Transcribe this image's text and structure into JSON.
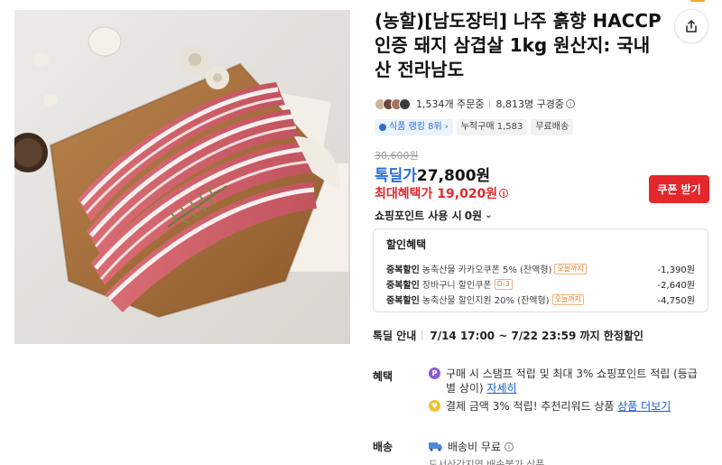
{
  "product": {
    "title": "(농할)[남도장터] 나주 흙향 HACCP인증 돼지 삼겹살 1kg 원산지: 국내산 전라남도",
    "image_alt": "삼겹살 product photo"
  },
  "stats": {
    "orders": "1,534개 주문중",
    "viewers": "8,813명 구경중"
  },
  "chips": {
    "rank": "식품 랭킹 8위",
    "cumulative": "누적구매 1,583",
    "free_shipping": "무료배송"
  },
  "price": {
    "original": "30,600원",
    "deal_label": "톡딜가",
    "deal_value": "27,800원",
    "max_benefit": "최대혜택가 19,020원",
    "coupon_button": "쿠폰 받기",
    "points": "쇼핑포인트 사용 시",
    "points_value": "0원"
  },
  "discounts": {
    "title": "할인혜택",
    "rows": [
      {
        "kind": "중복할인",
        "desc": "농축산물 카카오쿠폰 5% (잔액형)",
        "tag": "오늘까지",
        "amount": "-1,390원"
      },
      {
        "kind": "중복할인",
        "desc": "장바구니 할인쿠폰",
        "tag": "D-3",
        "amount": "-2,640원"
      },
      {
        "kind": "중복할인",
        "desc": "농축산물 할인지원 20% (잔액형)",
        "tag": "오늘까지",
        "amount": "-4,750원"
      }
    ]
  },
  "deal_notice": {
    "label": "톡딜 안내",
    "text": "7/14 17:00 ~ 7/22 23:59 까지 한정할인"
  },
  "benefits": {
    "label": "혜택",
    "item1_text": "구매 시 스탬프 적립 및 최대 3% 쇼핑포인트 적립 (등급별 상이)",
    "item1_link": "자세히",
    "item2_text": "결제 금액 3% 적립! 추천리워드 상품",
    "item2_link": "상품 더보기"
  },
  "shipping": {
    "label": "배송",
    "text": "배송비 무료",
    "sub": "도서산간지역 배송불가 상품"
  },
  "colors": {
    "accent_blue": "#2a6fd6",
    "accent_red": "#e3272c"
  }
}
